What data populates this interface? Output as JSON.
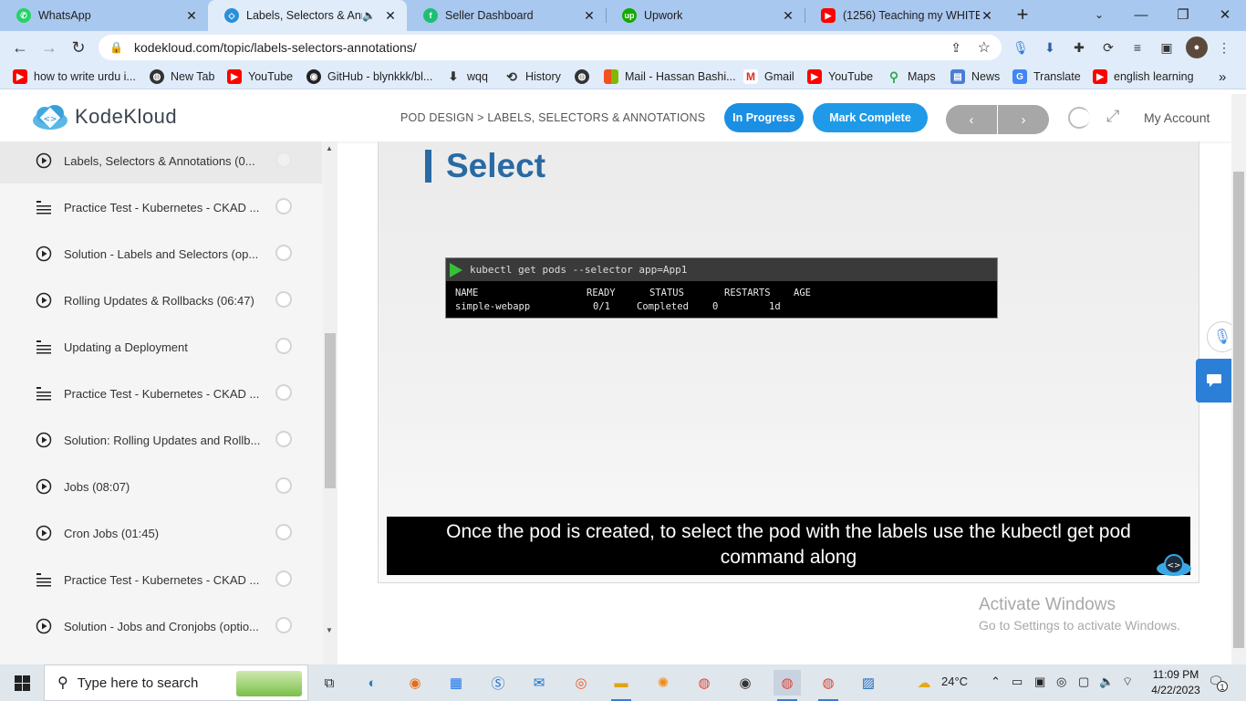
{
  "browser": {
    "tabs": [
      {
        "label": "WhatsApp",
        "icon": "whatsapp-icon",
        "color": "#25d366"
      },
      {
        "label": "Labels, Selectors & Anno",
        "icon": "kodekloud-icon",
        "color": "#2a8fd6"
      },
      {
        "label": "Seller Dashboard",
        "icon": "fiverr-icon",
        "color": "#1dbf73"
      },
      {
        "label": "Upwork",
        "icon": "upwork-icon",
        "color": "#14a800"
      },
      {
        "label": "(1256) Teaching my WHITE fi",
        "icon": "youtube-icon",
        "color": "#ff0000"
      }
    ],
    "url": "kodekloud.com/topic/labels-selectors-annotations/",
    "bookmarks": [
      {
        "label": "how to write urdu i...",
        "icon": "youtube-icon"
      },
      {
        "label": "New Tab",
        "icon": "globe-icon"
      },
      {
        "label": "YouTube",
        "icon": "youtube-icon"
      },
      {
        "label": "GitHub - blynkkk/bl...",
        "icon": "github-icon"
      },
      {
        "label": "wqq",
        "icon": "download-icon"
      },
      {
        "label": "History",
        "icon": "history-icon"
      },
      {
        "label": "",
        "icon": "globe-icon"
      },
      {
        "label": "Mail - Hassan Bashi...",
        "icon": "microsoft-icon"
      },
      {
        "label": "Gmail",
        "icon": "gmail-icon"
      },
      {
        "label": "YouTube",
        "icon": "youtube-icon"
      },
      {
        "label": "Maps",
        "icon": "maps-icon"
      },
      {
        "label": "News",
        "icon": "news-icon"
      },
      {
        "label": "Translate",
        "icon": "translate-icon"
      },
      {
        "label": "english learning",
        "icon": "youtube-icon"
      }
    ]
  },
  "header": {
    "logo_text": "KodeKloud",
    "breadcrumb": "POD DESIGN > LABELS, SELECTORS & ANNOTATIONS",
    "status_label": "In Progress",
    "complete_label": "Mark Complete",
    "prev_label": "‹",
    "next_label": "›",
    "account_label": "My Account",
    "accent": "#1a8fe3"
  },
  "sidebar": {
    "items": [
      {
        "title": "Labels, Selectors & Annotations (0...",
        "type": "video"
      },
      {
        "title": "Practice Test - Kubernetes - CKAD ...",
        "type": "lab"
      },
      {
        "title": "Solution - Labels and Selectors (op...",
        "type": "video"
      },
      {
        "title": "Rolling Updates & Rollbacks (06:47)",
        "type": "video"
      },
      {
        "title": "Updating a Deployment",
        "type": "lab"
      },
      {
        "title": "Practice Test - Kubernetes - CKAD ...",
        "type": "lab"
      },
      {
        "title": "Solution: Rolling Updates and Rollb...",
        "type": "video"
      },
      {
        "title": "Jobs (08:07)",
        "type": "video"
      },
      {
        "title": "Cron Jobs (01:45)",
        "type": "video"
      },
      {
        "title": "Practice Test - Kubernetes - CKAD ...",
        "type": "lab"
      },
      {
        "title": "Solution - Jobs and Cronjobs (optio...",
        "type": "video"
      }
    ]
  },
  "video": {
    "slide_title": "Select",
    "command": "kubectl get pods --selector app=App1",
    "columns": [
      "NAME",
      "READY",
      "STATUS",
      "RESTARTS",
      "AGE"
    ],
    "row": [
      "simple-webapp",
      "0/1",
      "Completed",
      "0",
      "1d"
    ],
    "caption_line1": "Once the pod is created, to select the pod with the labels use the kubectl get pod",
    "caption_line2": "command along"
  },
  "watermark": {
    "line1": "Activate Windows",
    "line2": "Go to Settings to activate Windows."
  },
  "taskbar": {
    "search_placeholder": "Type here to search",
    "weather": "24°C",
    "time": "11:09 PM",
    "date": "4/22/2023",
    "notification_count": "1"
  }
}
